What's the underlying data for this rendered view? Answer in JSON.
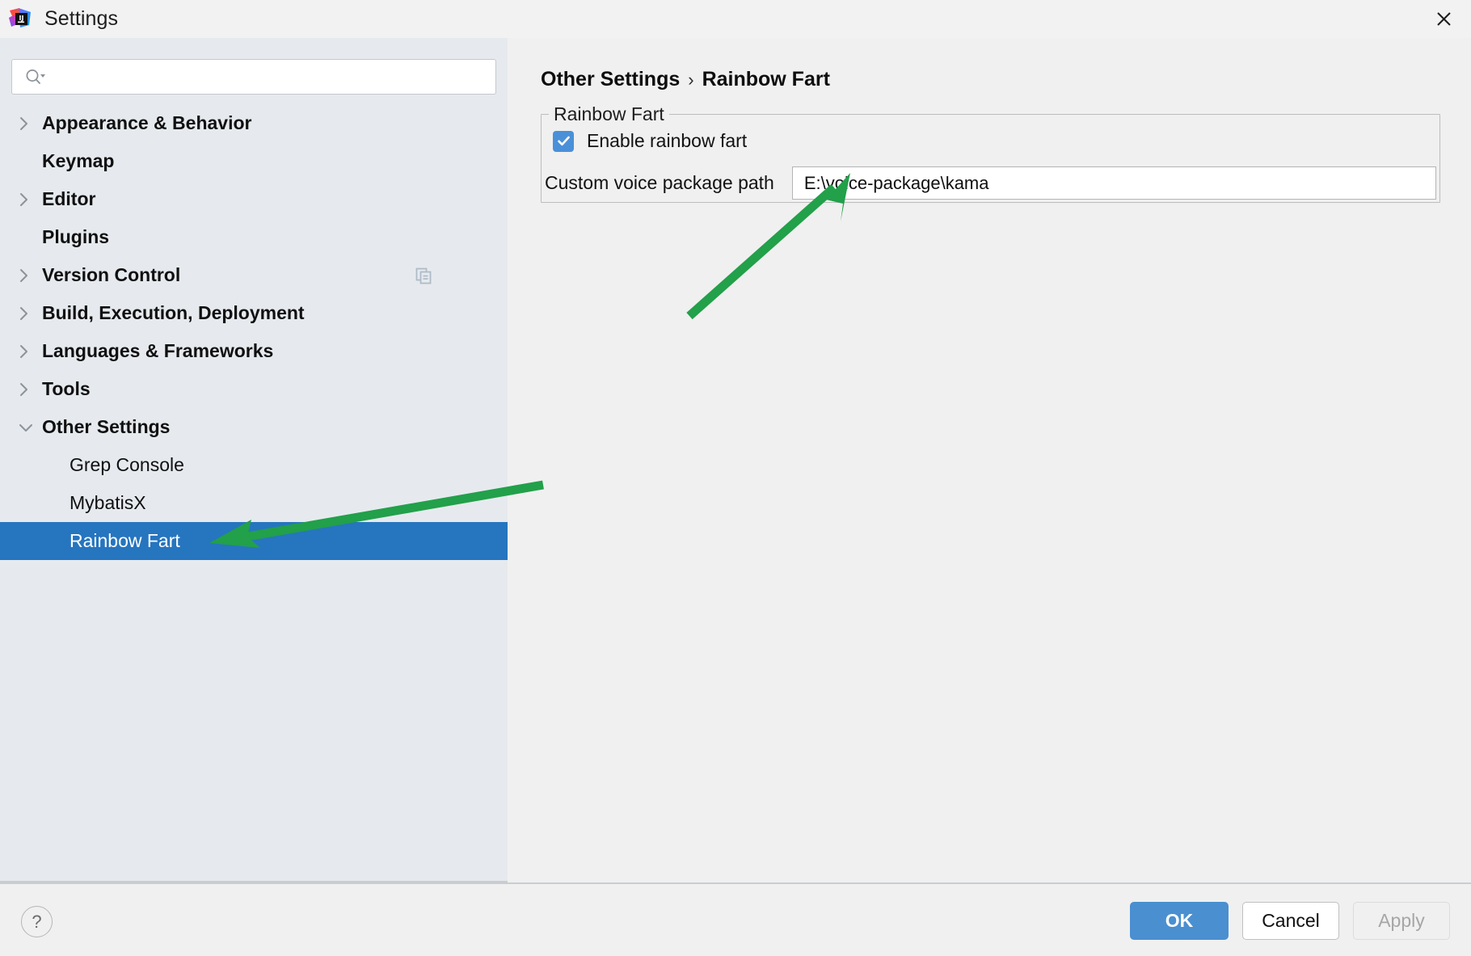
{
  "window": {
    "title": "Settings",
    "app_icon": "intellij-idea-icon",
    "close_label": "✕"
  },
  "search": {
    "value": "",
    "placeholder": "",
    "icon": "search-icon"
  },
  "sidebar": {
    "items": [
      {
        "label": "Appearance & Behavior",
        "expander": "chevron-right",
        "bold": true,
        "child": false,
        "selected": false,
        "aux_icon": ""
      },
      {
        "label": "Keymap",
        "expander": "none",
        "bold": true,
        "child": false,
        "selected": false,
        "aux_icon": ""
      },
      {
        "label": "Editor",
        "expander": "chevron-right",
        "bold": true,
        "child": false,
        "selected": false,
        "aux_icon": ""
      },
      {
        "label": "Plugins",
        "expander": "none",
        "bold": true,
        "child": false,
        "selected": false,
        "aux_icon": ""
      },
      {
        "label": "Version Control",
        "expander": "chevron-right",
        "bold": true,
        "child": false,
        "selected": false,
        "aux_icon": "copy-icon"
      },
      {
        "label": "Build, Execution, Deployment",
        "expander": "chevron-right",
        "bold": true,
        "child": false,
        "selected": false,
        "aux_icon": ""
      },
      {
        "label": "Languages & Frameworks",
        "expander": "chevron-right",
        "bold": true,
        "child": false,
        "selected": false,
        "aux_icon": ""
      },
      {
        "label": "Tools",
        "expander": "chevron-right",
        "bold": true,
        "child": false,
        "selected": false,
        "aux_icon": ""
      },
      {
        "label": "Other Settings",
        "expander": "chevron-down",
        "bold": true,
        "child": false,
        "selected": false,
        "aux_icon": ""
      },
      {
        "label": "Grep Console",
        "expander": "none",
        "bold": false,
        "child": true,
        "selected": false,
        "aux_icon": ""
      },
      {
        "label": "MybatisX",
        "expander": "none",
        "bold": false,
        "child": true,
        "selected": false,
        "aux_icon": ""
      },
      {
        "label": "Rainbow Fart",
        "expander": "none",
        "bold": false,
        "child": true,
        "selected": true,
        "aux_icon": ""
      }
    ]
  },
  "breadcrumb": {
    "parent": "Other Settings",
    "separator": "›",
    "current": "Rainbow Fart"
  },
  "panel": {
    "group_title": "Rainbow Fart",
    "checkbox": {
      "label": "Enable rainbow fart",
      "checked": true
    },
    "path_field": {
      "label": "Custom voice package path",
      "value": "E:\\voice-package\\kama",
      "placeholder": ""
    }
  },
  "footer": {
    "help_label": "?",
    "ok_label": "OK",
    "cancel_label": "Cancel",
    "apply_label": "Apply",
    "apply_enabled": false
  },
  "colors": {
    "selection_blue": "#2675bf",
    "primary_button": "#4a8fd0",
    "checkbox_blue": "#4a90d9",
    "sidebar_bg": "#e6eaee",
    "content_bg": "#f0f0f0",
    "annotation_green": "#22a04a"
  },
  "annotations": [
    {
      "name": "arrow-to-path-field",
      "target": "path-input"
    },
    {
      "name": "arrow-to-rainbow-fart-item",
      "target": "sidebar-item-rainbow-fart"
    }
  ]
}
